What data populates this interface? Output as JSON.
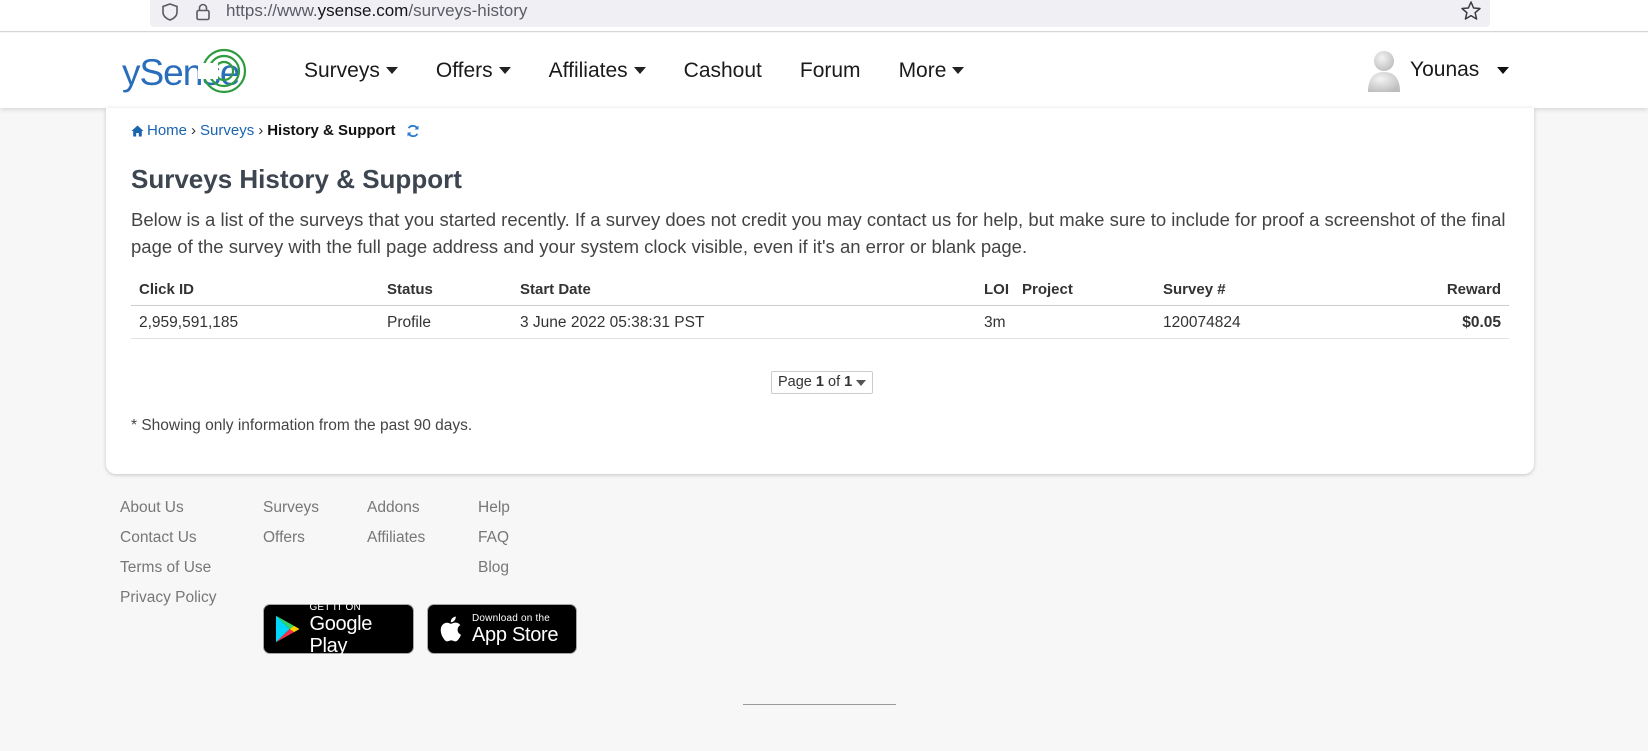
{
  "browser": {
    "url_prefix": "https://www.",
    "url_domain": "ysense.com",
    "url_path": "/surveys-history"
  },
  "header": {
    "logo_text": "ySense",
    "nav": [
      {
        "label": "Surveys",
        "has_menu": true
      },
      {
        "label": "Offers",
        "has_menu": true
      },
      {
        "label": "Affiliates",
        "has_menu": true
      },
      {
        "label": "Cashout",
        "has_menu": false
      },
      {
        "label": "Forum",
        "has_menu": false
      },
      {
        "label": "More",
        "has_menu": true
      }
    ],
    "user_name": "Younas"
  },
  "breadcrumb": {
    "home": "Home",
    "surveys": "Surveys",
    "current": "History & Support"
  },
  "main": {
    "title": "Surveys History & Support",
    "intro": "Below is a list of the surveys that you started recently. If a survey does not credit you may contact us for help, but make sure to include for proof a screenshot of the final page of the survey with the full page address and your system clock visible, even if it's an error or blank page.",
    "table": {
      "columns": {
        "click_id": "Click ID",
        "status": "Status",
        "start_date": "Start Date",
        "loi": "LOI",
        "project": "Project",
        "survey": "Survey #",
        "reward": "Reward"
      },
      "rows": [
        {
          "click_id": "2,959,591,185",
          "status": "Profile",
          "start_date": "3 June 2022 05:38:31 PST",
          "loi": "3m",
          "project": "",
          "survey": "120074824",
          "reward": "$0.05"
        }
      ]
    },
    "pager": {
      "prefix": "Page",
      "page": "1",
      "of": "of",
      "total": "1"
    },
    "note": "* Showing only information from the past 90 days."
  },
  "footer": {
    "col1": [
      "About Us",
      "Contact Us",
      "Terms of Use",
      "Privacy Policy"
    ],
    "col2": [
      "Surveys",
      "Offers"
    ],
    "col3": [
      "Addons",
      "Affiliates"
    ],
    "col4": [
      "Help",
      "FAQ",
      "Blog"
    ],
    "google_play": {
      "small": "GET IT ON",
      "big": "Google Play"
    },
    "app_store": {
      "small": "Download on the",
      "big": "App Store"
    }
  },
  "colors": {
    "link_blue": "#1a64b0",
    "logo_green": "#2e9b3e",
    "logo_blue": "#2a6ebb"
  }
}
